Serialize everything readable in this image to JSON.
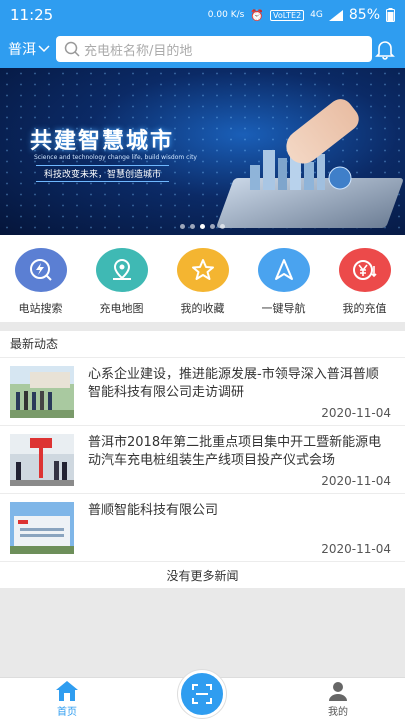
{
  "status_bar": {
    "time": "11:25",
    "speed": "0.00 K/s",
    "volte": "VoLTE2",
    "network": "4G",
    "battery": "85%"
  },
  "header": {
    "city": "普洱",
    "search_placeholder": "充电桩名称/目的地"
  },
  "banner": {
    "title": "共建智慧城市",
    "subtitle_en": "Science and technology change life, build wisdom city",
    "subtitle_cn": "科技改变未来，智慧创造城市"
  },
  "quick_actions": [
    {
      "label": "电站搜索",
      "icon": "search-lightning-icon",
      "color": "#5b7fd3"
    },
    {
      "label": "充电地图",
      "icon": "map-pin-icon",
      "color": "#3fb9b4"
    },
    {
      "label": "我的收藏",
      "icon": "star-icon",
      "color": "#f4b531"
    },
    {
      "label": "一键导航",
      "icon": "navigation-arrow-icon",
      "color": "#4aa3ef"
    },
    {
      "label": "我的充值",
      "icon": "yuan-coin-icon",
      "color": "#ec4a4a"
    }
  ],
  "news": {
    "heading": "最新动态",
    "items": [
      {
        "title": "心系企业建设，推进能源发展-市领导深入普洱普顺智能科技有限公司走访调研",
        "date": "2020-11-04"
      },
      {
        "title": "普洱市2018年第二批重点项目集中开工暨新能源电动汽车充电桩组装生产线项目投产仪式会场",
        "date": "2020-11-04"
      },
      {
        "title": "普顺智能科技有限公司",
        "date": "2020-11-04"
      }
    ],
    "no_more": "没有更多新闻"
  },
  "tabbar": {
    "home": "首页",
    "mine": "我的"
  }
}
